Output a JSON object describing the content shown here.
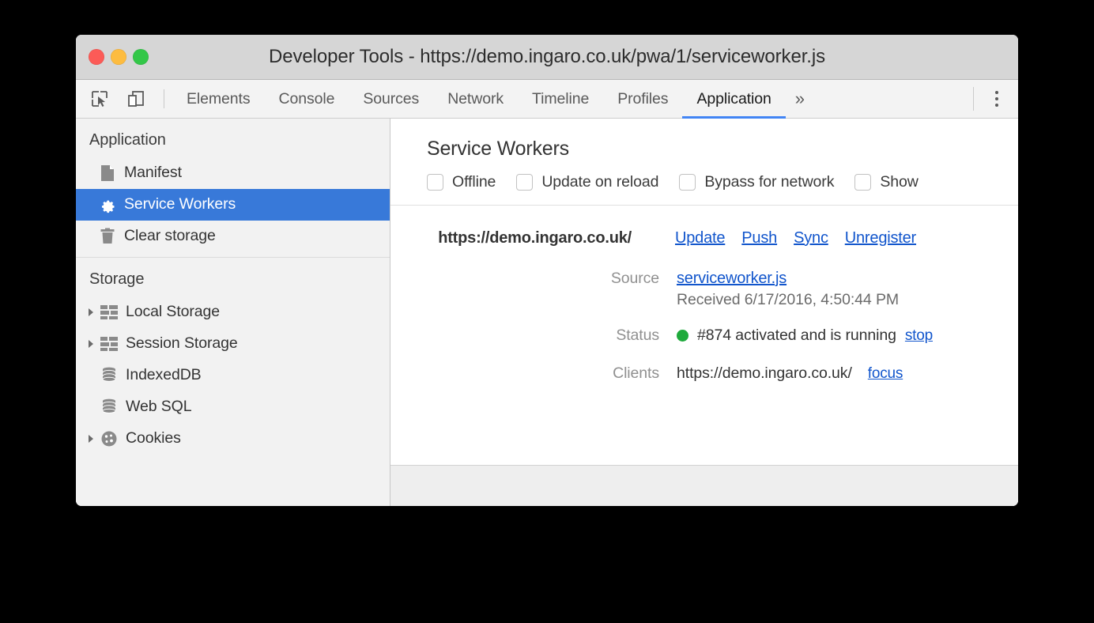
{
  "window": {
    "title": "Developer Tools - https://demo.ingaro.co.uk/pwa/1/serviceworker.js",
    "controls": {
      "close": "close",
      "minimize": "minimize",
      "maximize": "maximize"
    }
  },
  "toolbar": {
    "inspect_icon": "inspect-element-icon",
    "device_icon": "device-toolbar-icon",
    "overflow_label": "»",
    "menu_icon": "more-options-icon",
    "tabs": [
      {
        "label": "Elements",
        "active": false
      },
      {
        "label": "Console",
        "active": false
      },
      {
        "label": "Sources",
        "active": false
      },
      {
        "label": "Network",
        "active": false
      },
      {
        "label": "Timeline",
        "active": false
      },
      {
        "label": "Profiles",
        "active": false
      },
      {
        "label": "Application",
        "active": true
      }
    ],
    "active_tab_color": "#4285f4"
  },
  "sidebar": {
    "sections": [
      {
        "header": "Application",
        "items": [
          {
            "label": "Manifest",
            "icon": "document-icon",
            "expandable": false,
            "selected": false
          },
          {
            "label": "Service Workers",
            "icon": "gear-icon",
            "expandable": false,
            "selected": true
          },
          {
            "label": "Clear storage",
            "icon": "trash-icon",
            "expandable": false,
            "selected": false
          }
        ]
      },
      {
        "header": "Storage",
        "items": [
          {
            "label": "Local Storage",
            "icon": "table-icon",
            "expandable": true,
            "selected": false
          },
          {
            "label": "Session Storage",
            "icon": "table-icon",
            "expandable": true,
            "selected": false
          },
          {
            "label": "IndexedDB",
            "icon": "database-icon",
            "expandable": false,
            "selected": false
          },
          {
            "label": "Web SQL",
            "icon": "database-icon",
            "expandable": false,
            "selected": false
          },
          {
            "label": "Cookies",
            "icon": "cookie-icon",
            "expandable": true,
            "selected": false
          }
        ]
      }
    ],
    "selection_color": "#3879d9"
  },
  "main": {
    "title": "Service Workers",
    "options": [
      {
        "label": "Offline",
        "checked": false
      },
      {
        "label": "Update on reload",
        "checked": false
      },
      {
        "label": "Bypass for network",
        "checked": false
      },
      {
        "label": "Show",
        "checked": false
      }
    ],
    "registration": {
      "scope": "https://demo.ingaro.co.uk/",
      "actions": [
        {
          "label": "Update"
        },
        {
          "label": "Push"
        },
        {
          "label": "Sync"
        },
        {
          "label": "Unregister"
        }
      ],
      "source": {
        "label": "Source",
        "file": "serviceworker.js",
        "received": "Received 6/17/2016, 4:50:44 PM"
      },
      "status": {
        "label": "Status",
        "indicator_color": "#1faa3c",
        "text": "#874 activated and is running",
        "action": "stop"
      },
      "clients": {
        "label": "Clients",
        "url": "https://demo.ingaro.co.uk/",
        "action": "focus"
      }
    }
  }
}
